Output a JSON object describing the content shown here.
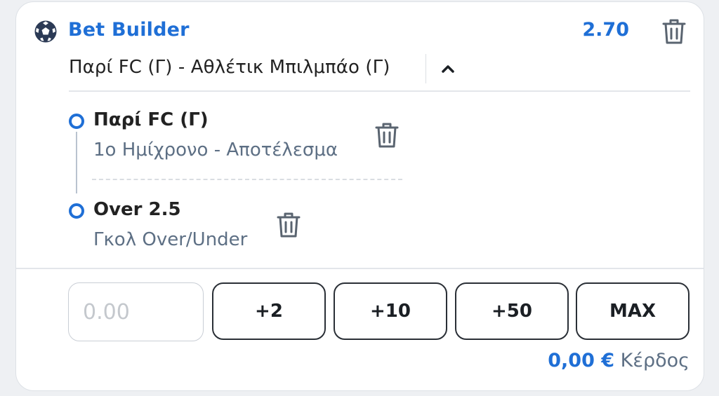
{
  "header": {
    "title": "Bet Builder",
    "odds": "2.70",
    "icon": "soccer-ball-icon"
  },
  "match": {
    "name": "Παρί FC (Γ) - Αθλέτικ Μπιλμπάο (Γ)",
    "toggle_icon": "chevron-up-icon",
    "expanded": true
  },
  "selections": [
    {
      "title": "Παρί FC (Γ)",
      "market": "1ο Ημίχρονο - Αποτέλεσμα"
    },
    {
      "title": "Over 2.5",
      "market": "Γκολ Over/Under"
    }
  ],
  "stake": {
    "placeholder": "0.00"
  },
  "quick_stakes": [
    "+2",
    "+10",
    "+50",
    "MAX"
  ],
  "winnings": {
    "amount": "0,00 €",
    "label": "Κέρδος"
  },
  "colors": {
    "accent": "#1f6fd6",
    "text": "#222222",
    "muted": "#5d6f84",
    "border": "#dde1e6",
    "button_border": "#2a2f36"
  }
}
